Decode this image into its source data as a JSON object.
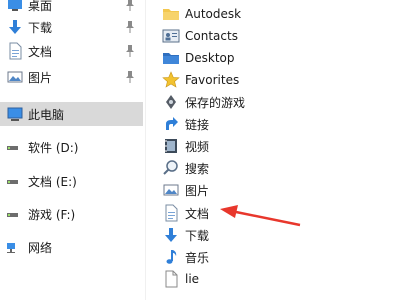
{
  "nav": {
    "items": [
      {
        "label": "桌面",
        "icon": "desktop-icon"
      },
      {
        "label": "下载",
        "icon": "download-arrow-icon"
      },
      {
        "label": "文档",
        "icon": "document-icon"
      },
      {
        "label": "图片",
        "icon": "pictures-icon"
      },
      {
        "label": "此电脑",
        "icon": "this-pc-icon"
      },
      {
        "label": "软件 (D:)",
        "icon": "drive-icon"
      },
      {
        "label": "文档 (E:)",
        "icon": "drive-icon"
      },
      {
        "label": "游戏 (F:)",
        "icon": "drive-icon"
      },
      {
        "label": "网络",
        "icon": "network-icon"
      }
    ]
  },
  "folders": {
    "items": [
      {
        "label": "Autodesk",
        "icon": "folder-icon"
      },
      {
        "label": "Contacts",
        "icon": "contacts-icon"
      },
      {
        "label": "Desktop",
        "icon": "desktop-folder-icon"
      },
      {
        "label": "Favorites",
        "icon": "star-icon"
      },
      {
        "label": "保存的游戏",
        "icon": "saved-games-icon"
      },
      {
        "label": "链接",
        "icon": "link-icon"
      },
      {
        "label": "视频",
        "icon": "video-icon"
      },
      {
        "label": "搜索",
        "icon": "search-icon"
      },
      {
        "label": "图片",
        "icon": "pictures-icon"
      },
      {
        "label": "文档",
        "icon": "document-icon"
      },
      {
        "label": "下载",
        "icon": "download-arrow-icon"
      },
      {
        "label": "音乐",
        "icon": "music-note-icon"
      },
      {
        "label": "lie",
        "icon": "blank-file-icon"
      }
    ]
  },
  "colors": {
    "selected_bg": "#d9d9d9",
    "folder_yellow": "#f3c74e",
    "download_blue": "#2f7fd8",
    "annotation_red": "#e8372c"
  }
}
